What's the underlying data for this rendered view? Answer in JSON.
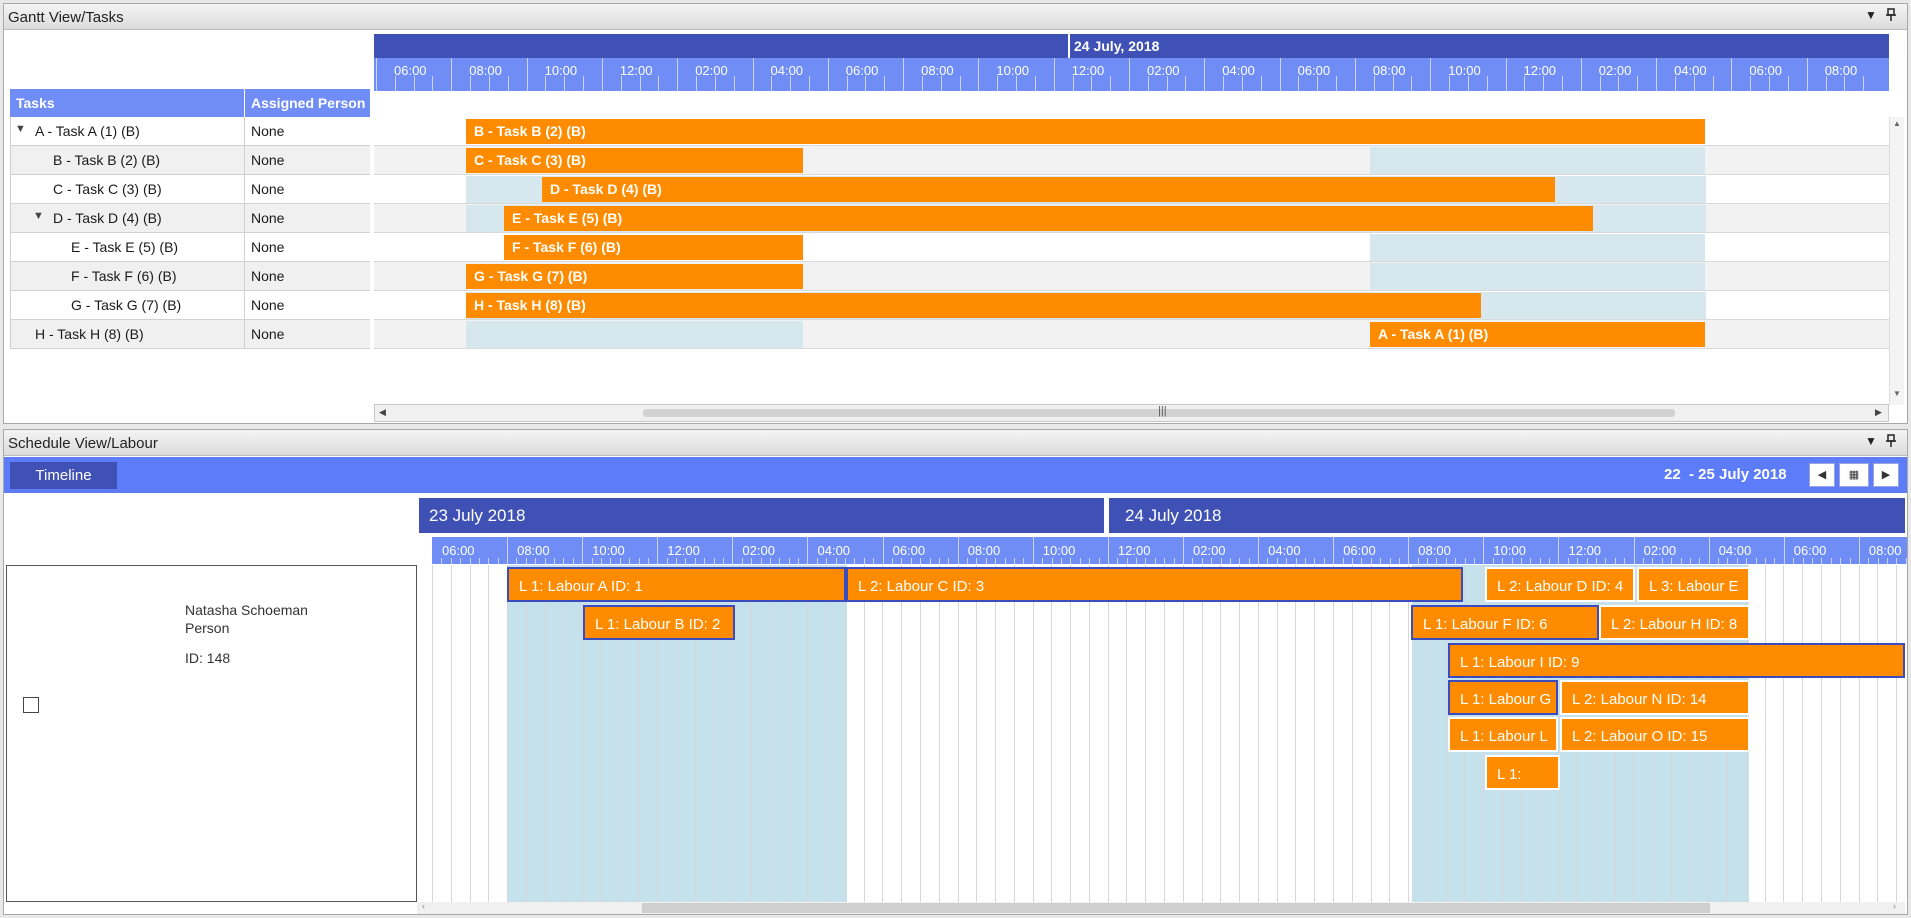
{
  "gantt": {
    "title": "Gantt View/Tasks",
    "pin_icon": "pin-icon",
    "menu_icon": "dropdown-arrow-icon",
    "header_date": "24 July, 2018",
    "hours": [
      "06:00",
      "08:00",
      "10:00",
      "12:00",
      "02:00",
      "04:00",
      "06:00",
      "08:00",
      "10:00",
      "12:00",
      "02:00",
      "04:00",
      "06:00",
      "08:00",
      "10:00",
      "12:00",
      "02:00",
      "04:00",
      "06:00",
      "08:00"
    ],
    "col_tasks": "Tasks",
    "col_person": "Assigned Person",
    "rows": [
      {
        "name": "A - Task A (1) (B)",
        "person": "None",
        "expander": "▼"
      },
      {
        "name": "B - Task B (2) (B)",
        "person": "None",
        "expander": ""
      },
      {
        "name": "C - Task C (3) (B)",
        "person": "None",
        "expander": ""
      },
      {
        "name": "D - Task D (4) (B)",
        "person": "None",
        "expander": "▼"
      },
      {
        "name": "E - Task E (5) (B)",
        "person": "None",
        "expander": ""
      },
      {
        "name": "F - Task F (6) (B)",
        "person": "None",
        "expander": ""
      },
      {
        "name": "G - Task G (7) (B)",
        "person": "None",
        "expander": ""
      },
      {
        "name": "H - Task H (8) (B)",
        "person": "None",
        "expander": ""
      }
    ],
    "bars": [
      "B - Task B (2) (B)",
      "C - Task C (3) (B)",
      "D - Task D (4) (B)",
      "E - Task E (5) (B)",
      "F - Task F (6) (B)",
      "G - Task G (7) (B)",
      "H - Task H (8) (B)",
      "A - Task A (1) (B)"
    ]
  },
  "schedule": {
    "title": "Schedule View/Labour",
    "timeline_button": "Timeline",
    "date_range": "22  - 25 July 2018",
    "nav_prev_icon": "chevron-left-icon",
    "nav_calendar_icon": "calendar-icon",
    "nav_next_icon": "chevron-right-icon",
    "day1": "23 July 2018",
    "day2": "24 July 2018",
    "hours": [
      "06:00",
      "08:00",
      "10:00",
      "12:00",
      "02:00",
      "04:00",
      "06:00",
      "08:00",
      "10:00",
      "12:00",
      "02:00",
      "04:00",
      "06:00",
      "08:00",
      "10:00",
      "12:00",
      "02:00",
      "04:00",
      "06:00",
      "08:00"
    ],
    "resource": {
      "name": "Natasha Schoeman",
      "type": "Person",
      "id": "ID: 148"
    },
    "appointments": [
      "L 1: Labour A  ID: 1",
      "L 2: Labour C  ID: 3",
      "L 2: Labour D  ID: 4",
      "L 3: Labour E",
      "L 1: Labour B  ID: 2",
      "L 1: Labour F  ID: 6",
      "L 2: Labour H  ID: 8",
      "L 1: Labour I  ID: 9",
      "L 1: Labour G",
      "L 2: Labour N  ID: 14",
      "L 1: Labour L",
      "L 2: Labour O  ID: 15",
      "L 1:"
    ]
  },
  "colors": {
    "bar": "#ff8c00",
    "header_dark": "#3f51b5",
    "header_light": "#6f8df5",
    "highlight": "#c5e2ec"
  }
}
